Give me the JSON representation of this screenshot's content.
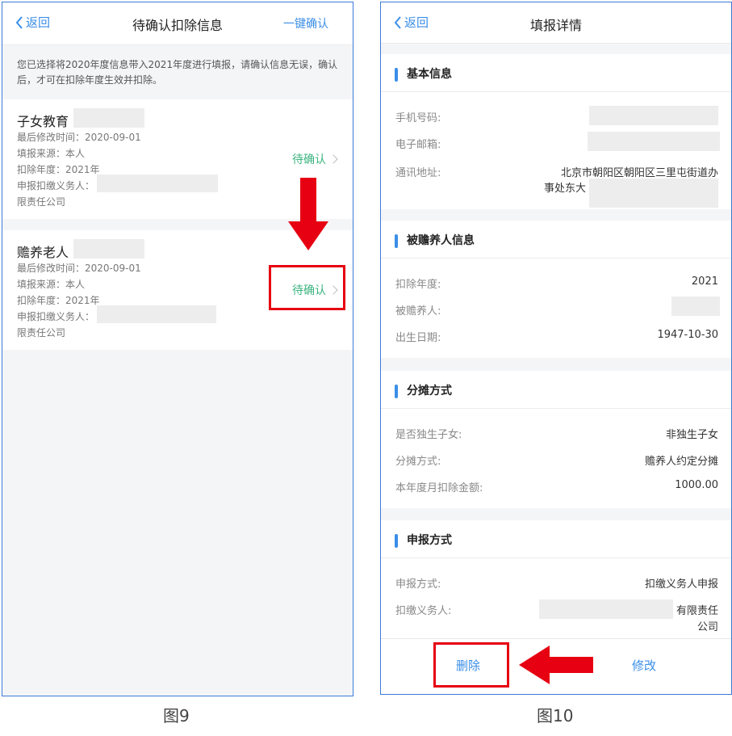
{
  "left": {
    "nav": {
      "back": "返回",
      "title": "待确认扣除信息",
      "action": "一键确认"
    },
    "notice": "您已选择将2020年度信息带入2021年度进行填报，请确认信息无误，确认后，才可在扣除年度生效并扣除。",
    "items": [
      {
        "title": "子女教育",
        "modified": "最后修改时间：2020-09-01",
        "source": "填报来源：本人",
        "year": "扣除年度：2021年",
        "agent": "申报扣缴义务人：",
        "company_suffix": "限责任公司",
        "status": "待确认"
      },
      {
        "title": "赡养老人",
        "modified": "最后修改时间：2020-09-01",
        "source": "填报来源：本人",
        "year": "扣除年度：2021年",
        "agent": "申报扣缴义务人：",
        "company_suffix": "限责任公司",
        "status": "待确认"
      }
    ],
    "caption": "图9"
  },
  "right": {
    "nav": {
      "back": "返回",
      "title": "填报详情"
    },
    "basic": {
      "title": "基本信息",
      "phone_label": "手机号码:",
      "email_label": "电子邮箱:",
      "address_label": "通讯地址:",
      "address_line1": "北京市朝阳区朝阳区三里屯街道办",
      "address_line2": "事处东大"
    },
    "supported": {
      "title": "被赡养人信息",
      "year_label": "扣除年度:",
      "year_value": "2021",
      "person_label": "被赡养人:",
      "birth_label": "出生日期:",
      "birth_value": "1947-10-30"
    },
    "split": {
      "title": "分摊方式",
      "only_child_label": "是否独生子女:",
      "only_child_value": "非独生子女",
      "method_label": "分摊方式:",
      "method_value": "赡养人约定分摊",
      "amount_label": "本年度月扣除金额:",
      "amount_value": "1000.00"
    },
    "declare": {
      "title": "申报方式",
      "method_label": "申报方式:",
      "method_value": "扣缴义务人申报",
      "agent_label": "扣缴义务人:",
      "agent_value_line1": "有限责任",
      "agent_value_line2": "公司"
    },
    "actions": {
      "delete": "删除",
      "modify": "修改"
    },
    "caption": "图10"
  },
  "colors": {
    "accent": "#3a8ee6",
    "pending": "#3bb47e",
    "highlight": "#e60012"
  }
}
